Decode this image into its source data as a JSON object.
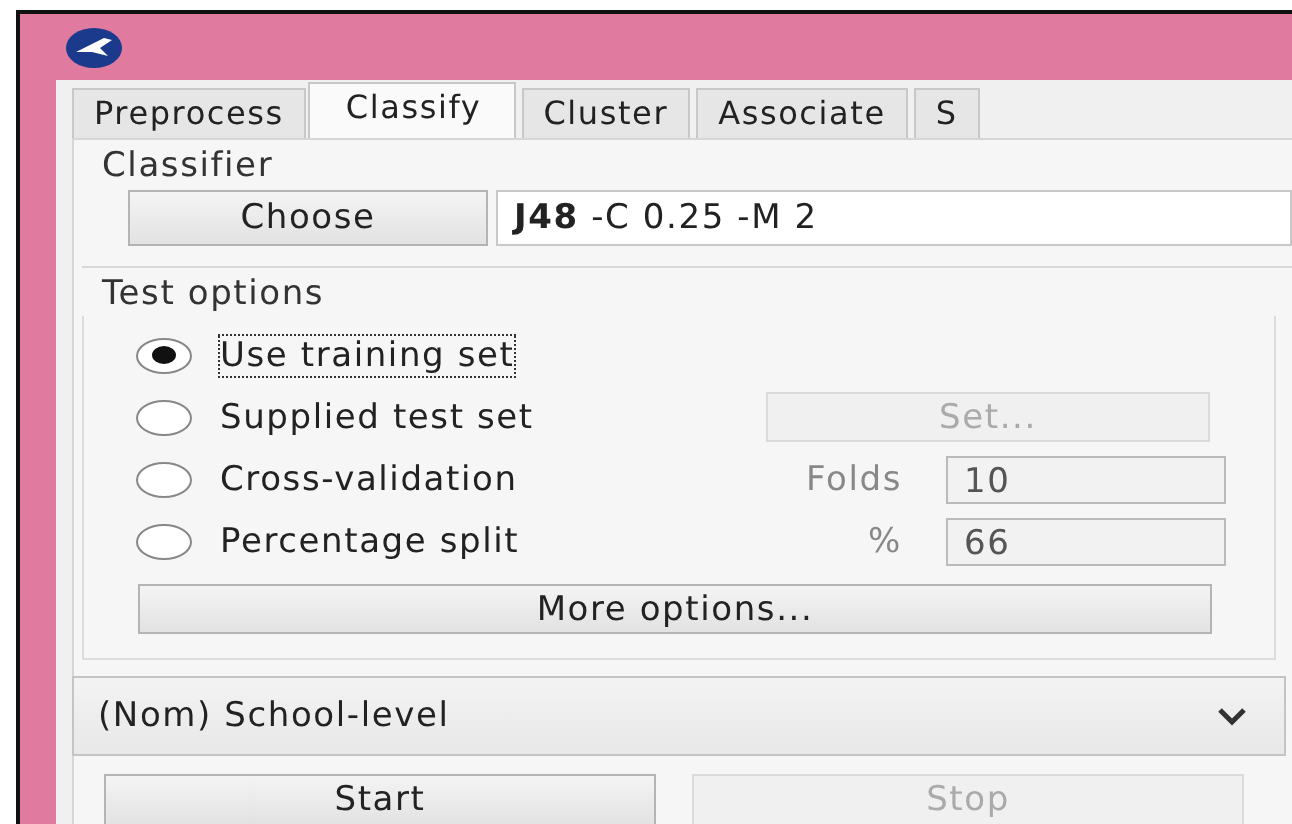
{
  "tabs": [
    {
      "label": "Preprocess",
      "selected": false
    },
    {
      "label": "Classify",
      "selected": true
    },
    {
      "label": "Cluster",
      "selected": false
    },
    {
      "label": "Associate",
      "selected": false
    },
    {
      "label": "S",
      "selected": false
    }
  ],
  "classifier": {
    "group_label": "Classifier",
    "choose_button": "Choose",
    "scheme": "**J48** -C 0.25 -M 2"
  },
  "test_options": {
    "group_label": "Test options",
    "options": [
      {
        "label": "Use training set",
        "selected": true,
        "focused": true
      },
      {
        "label": "Supplied test set",
        "selected": false,
        "focused": false,
        "extra": {
          "kind": "button",
          "label": "Set...",
          "disabled": true
        }
      },
      {
        "label": "Cross-validation",
        "selected": false,
        "focused": false,
        "extra": {
          "kind": "field",
          "label": "Folds",
          "value": "10",
          "disabled": true
        }
      },
      {
        "label": "Percentage split",
        "selected": false,
        "focused": false,
        "extra": {
          "kind": "field",
          "label": "%",
          "value": "66",
          "disabled": true
        }
      }
    ],
    "more_button": "More options..."
  },
  "class_selector": {
    "value": "(Nom) School-level"
  },
  "buttons": [
    {
      "label": "Start",
      "disabled": false
    },
    {
      "label": "Stop",
      "disabled": true
    }
  ]
}
